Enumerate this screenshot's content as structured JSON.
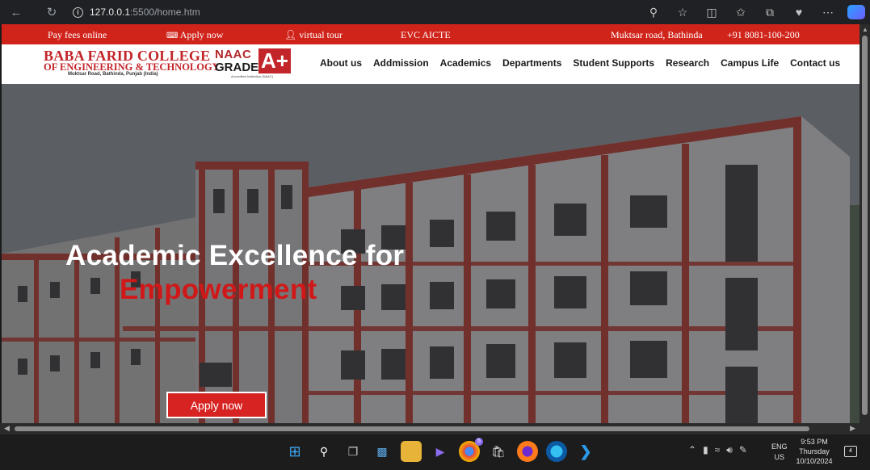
{
  "browser": {
    "url_host": "127.0.0.1",
    "url_path": ":5500/home.htm"
  },
  "topbar": {
    "pay_fees": "Pay fees online",
    "apply_now": "Apply now",
    "virtual_tour": "virtual tour",
    "evc": "EVC AICTE",
    "address": "Muktsar road, Bathinda",
    "phone": "+91 8081-100-200"
  },
  "logo": {
    "name_line1": "BABA FARID COLLEGE",
    "name_line2": "OF ENGINEERING & TECHNOLOGY",
    "address": "Muktsar Road, Bathinda, Punjab (India)",
    "naac": "NAAC",
    "grade": "GRADE",
    "grade_value": "A+",
    "accredited": "Accredited Institution (NAAC)"
  },
  "nav": {
    "items": [
      "About us",
      "Addmission",
      "Academics",
      "Departments",
      "Student Supports",
      "Research",
      "Campus Life",
      "Contact us"
    ]
  },
  "hero": {
    "title": "Academic Excellence for",
    "subtitle": "Empowerment",
    "button": "Apply now"
  },
  "taskbar": {
    "lang_line1": "ENG",
    "lang_line2": "US",
    "time": "9:53 PM",
    "day": "Thursday",
    "date": "10/10/2024",
    "notifications": "4",
    "chrome_badge": "5"
  },
  "colors": {
    "brand_red": "#d0241b",
    "header_bg": "#ffffff",
    "hero_title": "#ffffff",
    "hero_subtitle": "#d01818"
  }
}
